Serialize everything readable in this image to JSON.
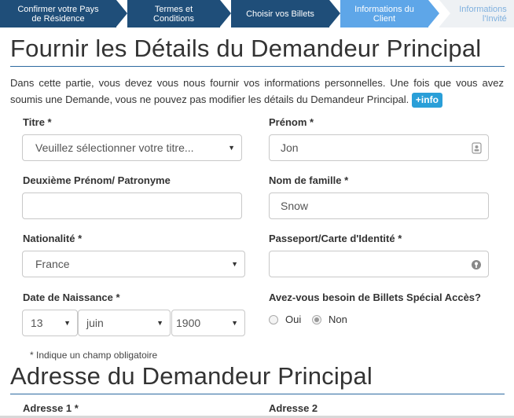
{
  "steps": [
    {
      "line1": "Confirmer votre Pays",
      "line2": "de Résidence"
    },
    {
      "line1": "Termes et",
      "line2": "Conditions"
    },
    {
      "line1": "Choisir vos Billets",
      "line2": ""
    },
    {
      "line1": "Informations du",
      "line2": "Client"
    },
    {
      "line1": "Informations",
      "line2": "l'Invité"
    }
  ],
  "section1": {
    "title": "Fournir les Détails du Demandeur Principal",
    "intro": "Dans cette partie, vous devez vous nous fournir vos informations personnelles. Une fois que vous avez soumis une Demande, vous ne pouvez pas modifier les détails du Demandeur Principal.",
    "info_button": "+info"
  },
  "form": {
    "titre_label": "Titre *",
    "titre_value": "Veuillez sélectionner votre titre...",
    "prenom_label": "Prénom *",
    "prenom_value": "Jon",
    "deuxieme_label": "Deuxième Prénom/ Patronyme",
    "deuxieme_value": "",
    "nom_label": "Nom de famille *",
    "nom_value": "Snow",
    "nationalite_label": "Nationalité *",
    "nationalite_value": "France",
    "passeport_label": "Passeport/Carte d'Identité *",
    "passeport_value": "",
    "naissance_label": "Date de Naissance *",
    "day_value": "13",
    "month_value": "juin",
    "year_value": "1900",
    "acces_label": "Avez-vous besoin de Billets Spécial Accès?",
    "oui_label": "Oui",
    "non_label": "Non",
    "required_note": "* Indique un champ obligatoire"
  },
  "section2": {
    "title": "Adresse du Demandeur Principal",
    "adresse1_label": "Adresse 1 *",
    "adresse2_label": "Adresse 2"
  },
  "colors": {
    "step_dark": "#1f4e79",
    "step_active": "#5ea6e8",
    "accent_rule": "#2c6aa0",
    "info_button": "#2a9fd8"
  }
}
